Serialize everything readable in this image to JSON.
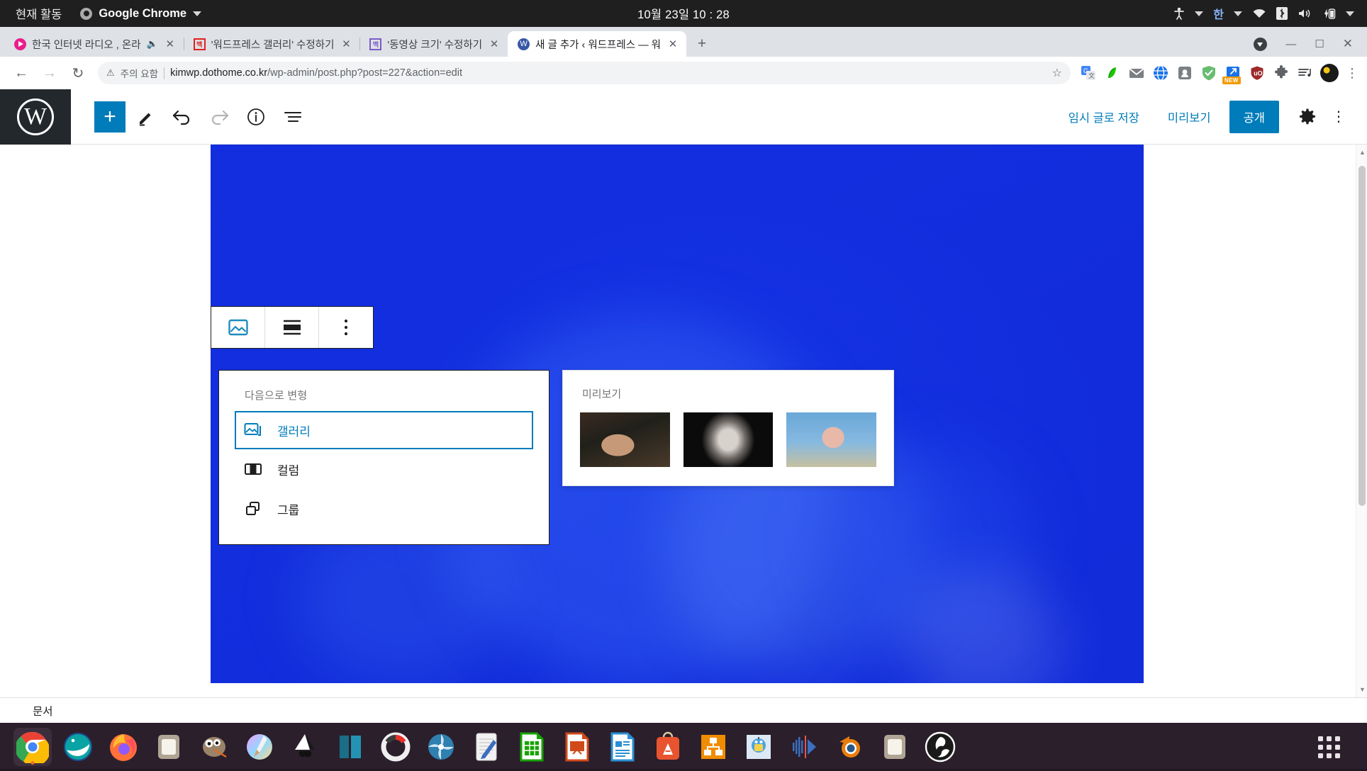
{
  "system_bar": {
    "activities_label": "현재 활동",
    "app_name": "Google Chrome",
    "clock": "10월 23일  10 : 28",
    "indicators": {
      "accessibility_icon": "accessibility-icon",
      "input_method": "한",
      "wifi_icon": "wifi-icon",
      "bluetooth_icon": "bluetooth-icon",
      "volume_icon": "volume-icon",
      "battery_icon": "battery-charging-icon"
    }
  },
  "browser": {
    "tabs": [
      {
        "title": "한국 인터넷 라디오 , 온라",
        "favicon": "radio-icon",
        "active": false,
        "audio": true
      },
      {
        "title": "'워드프레스 갤러리' 수정하기",
        "favicon": "baek-red-icon",
        "active": false,
        "audio": false
      },
      {
        "title": "'동영상 크기' 수정하기",
        "favicon": "baek-purple-icon",
        "active": false,
        "audio": false
      },
      {
        "title": "새 글 추가 ‹ 워드프레스 — 워",
        "favicon": "wordpress-icon",
        "active": true,
        "audio": false
      }
    ],
    "new_tab_label": "+",
    "window_controls": {
      "minimize": "—",
      "maximize": "▢",
      "close": "✕"
    },
    "omnibox": {
      "security_label": "주의 요함",
      "url_host": "kimwp.dothome.co.kr",
      "url_path": "/wp-admin/post.php?post=227&action=edit",
      "bookmark_icon": "star-icon"
    },
    "extensions": [
      "google-translate-icon",
      "papago-icon",
      "mail-icon",
      "globe-icon",
      "pocket-icon",
      "adguard-shield-icon",
      "share-new-icon",
      "ublock-origin-icon",
      "puzzle-extensions-icon",
      "playlist-music-icon",
      "profile-avatar",
      "chrome-menu-icon"
    ],
    "extension_badge": "NEW"
  },
  "wp_editor": {
    "logo": "wordpress-logo",
    "toolbar_icons": [
      "add-block-icon",
      "edit-pencil-icon",
      "undo-icon",
      "redo-icon",
      "info-icon",
      "list-view-icon"
    ],
    "save_draft_label": "임시 글로 저장",
    "preview_label": "미리보기",
    "publish_label": "공개",
    "settings_icon": "gear-icon",
    "more_icon": "vertical-dots-icon",
    "block_toolbar": {
      "items": [
        "image-block-icon",
        "align-icon",
        "more-options-icon"
      ],
      "selected_index": 0
    },
    "transform_panel": {
      "heading": "다음으로 변형",
      "options": [
        {
          "label": "갤러리",
          "icon": "gallery-icon",
          "selected": true
        },
        {
          "label": "컬럼",
          "icon": "columns-icon",
          "selected": false
        },
        {
          "label": "그룹",
          "icon": "group-icon",
          "selected": false
        }
      ]
    },
    "preview_panel": {
      "heading": "미리보기",
      "thumbnails": [
        "photo-boy-hoodie",
        "photo-woman-bw",
        "photo-man-lemon"
      ]
    },
    "footer_tab": "문서"
  },
  "dock": {
    "items": [
      {
        "name": "google-chrome",
        "running": true
      },
      {
        "name": "thunderbird"
      },
      {
        "name": "firefox"
      },
      {
        "name": "files"
      },
      {
        "name": "gimp"
      },
      {
        "name": "krita"
      },
      {
        "name": "inkscape"
      },
      {
        "name": "video-editor"
      },
      {
        "name": "handbrake"
      },
      {
        "name": "darktable"
      },
      {
        "name": "text-editor"
      },
      {
        "name": "libreoffice-calc"
      },
      {
        "name": "libreoffice-impress"
      },
      {
        "name": "libreoffice-writer"
      },
      {
        "name": "app-store"
      },
      {
        "name": "mindmap"
      },
      {
        "name": "robot-app"
      },
      {
        "name": "audio-editor"
      },
      {
        "name": "blender"
      },
      {
        "name": "file-manager"
      },
      {
        "name": "obs-studio"
      }
    ],
    "show_apps_label": "show-applications"
  },
  "colors": {
    "wp_blue": "#007cba",
    "chrome_tabstrip": "#dee1e6",
    "gnome_bar": "#1f1f1f",
    "dock_bg": "#2b1f2c",
    "image_overlay_blue": "#1530e8"
  }
}
